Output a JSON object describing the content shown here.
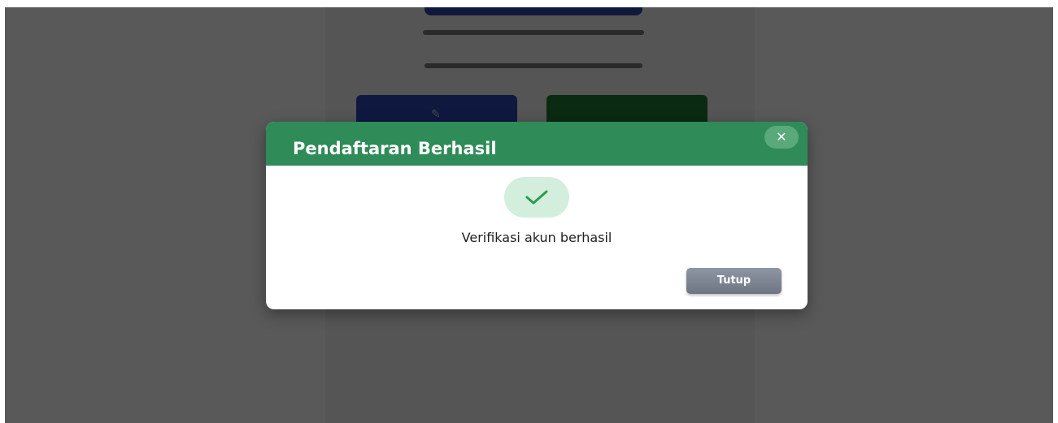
{
  "modal": {
    "title": "Pendaftaran Berhasil",
    "close_icon": "close-icon",
    "close_glyph": "✕",
    "success_icon": "check-icon",
    "message": "Verifikasi akun berhasil",
    "footer_button_label": "Tutup"
  },
  "colors": {
    "header": "#2f8b57",
    "success_bg": "#d3eedc",
    "success_check": "#2e9c4d",
    "footer_button": "#7d8391",
    "overlay": "rgba(0,0,0,0.65)"
  }
}
